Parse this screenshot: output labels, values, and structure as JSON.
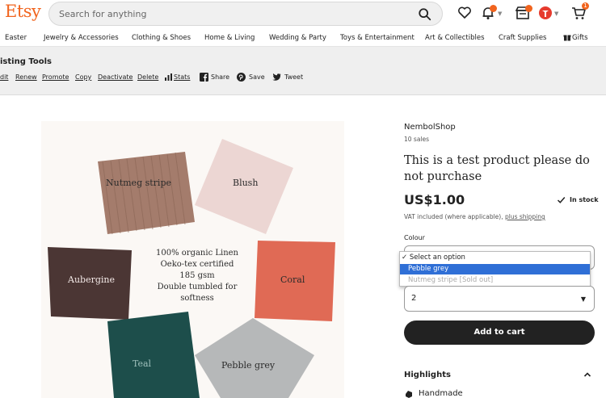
{
  "header": {
    "logo": "Etsy",
    "search_placeholder": "Search for anything",
    "cart_count": "1"
  },
  "categories": [
    "Easter",
    "Jewelry & Accessories",
    "Clothing & Shoes",
    "Home & Living",
    "Wedding & Party",
    "Toys & Entertainment",
    "Art & Collectibles",
    "Craft Supplies",
    "Gifts"
  ],
  "listing_tools": {
    "title": "isting Tools",
    "links": [
      "dit",
      "Renew",
      "Promote",
      "Copy",
      "Deactivate",
      "Delete",
      "Stats"
    ],
    "share": "Share",
    "save": "Save",
    "tweet": "Tweet"
  },
  "image": {
    "swatches": [
      "Nutmeg stripe",
      "Blush",
      "Aubergine",
      "Coral",
      "Teal",
      "Pebble grey"
    ],
    "center_lines": [
      "100% organic Linen",
      "Oeko-tex certified",
      "185 gsm",
      "Double tumbled for",
      "softness"
    ]
  },
  "product": {
    "shop": "NembolShop",
    "sales": "10 sales",
    "title": "This is a test product please do not purchase",
    "price": "US$1.00",
    "stock": "In stock",
    "vat_text": "VAT included (where applicable),",
    "shipping_link": "plus shipping",
    "colour_label": "Colour",
    "colour_options": [
      "Select an option",
      "Pebble grey",
      "Nutmeg stripe [Sold out]"
    ],
    "quantity": "2",
    "add_to_cart": "Add to cart",
    "highlights": "Highlights",
    "handmade": "Handmade"
  },
  "colors": {
    "brand": "#f1641e",
    "highlight": "#2f6fd6",
    "button": "#222222"
  }
}
